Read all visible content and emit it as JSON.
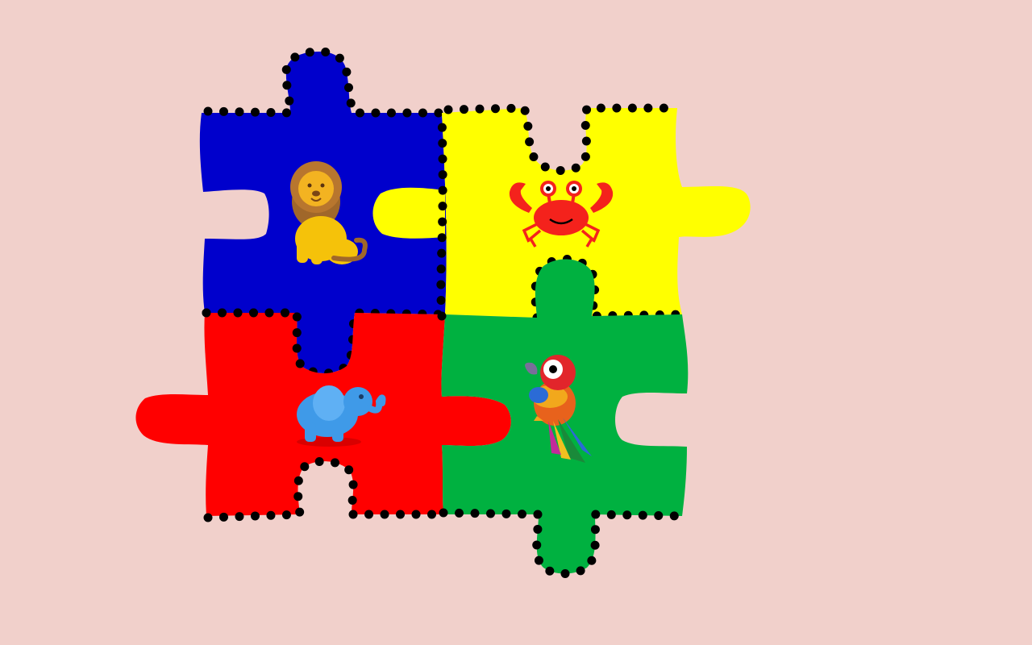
{
  "game": {
    "type": "jigsaw-puzzle",
    "background_color": "#f1d0cb",
    "border_style": "black dotted outline",
    "pieces": [
      {
        "id": "blue",
        "color": "#0000cc",
        "animal": "lion",
        "icon": "lion-icon"
      },
      {
        "id": "yellow",
        "color": "#ffff00",
        "animal": "crab",
        "icon": "crab-icon"
      },
      {
        "id": "red",
        "color": "#ff0000",
        "animal": "elephant",
        "icon": "elephant-icon"
      },
      {
        "id": "green",
        "color": "#00b140",
        "animal": "parrot",
        "icon": "parrot-icon"
      }
    ]
  }
}
